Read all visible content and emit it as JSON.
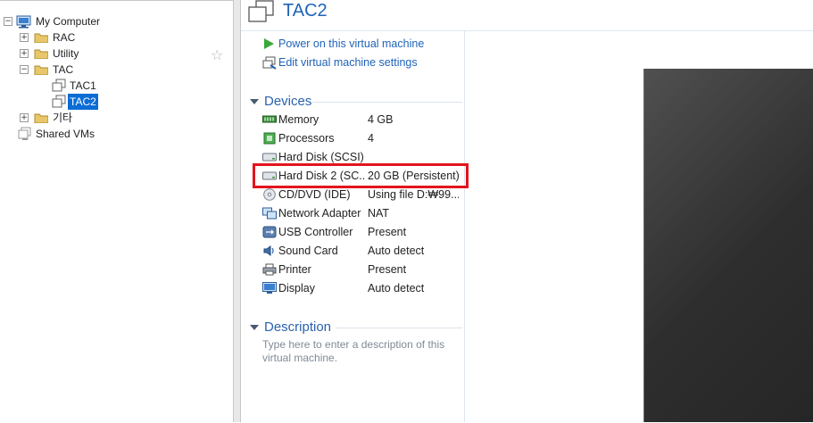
{
  "tree": {
    "root": {
      "label": "My Computer",
      "expander": "−"
    },
    "items": [
      {
        "label": "RAC",
        "expander": "+"
      },
      {
        "label": "Utility",
        "expander": "+"
      },
      {
        "label": "TAC",
        "expander": "−"
      },
      {
        "label": "TAC1"
      },
      {
        "label": "TAC2",
        "selected": true
      },
      {
        "label": "기타",
        "expander": "+"
      },
      {
        "label": "Shared VMs"
      }
    ],
    "favorite_icon": "star-icon",
    "favorite_glyph": "☆"
  },
  "vm": {
    "title": "TAC2",
    "commands": {
      "power_on": "Power on this virtual machine",
      "edit_settings": "Edit virtual machine settings"
    }
  },
  "devices": {
    "heading": "Devices",
    "items": [
      {
        "name": "Memory",
        "value": "4 GB",
        "icon": "memory-icon"
      },
      {
        "name": "Processors",
        "value": "4",
        "icon": "processor-icon"
      },
      {
        "name": "Hard Disk (SCSI)",
        "value": "",
        "icon": "hard-disk-icon"
      },
      {
        "name": "Hard Disk 2 (SC...",
        "value": "20 GB (Persistent)",
        "icon": "hard-disk-icon"
      },
      {
        "name": "CD/DVD (IDE)",
        "value": "Using file D:₩99...",
        "icon": "cd-dvd-icon"
      },
      {
        "name": "Network Adapter",
        "value": "NAT",
        "icon": "network-adapter-icon"
      },
      {
        "name": "USB Controller",
        "value": "Present",
        "icon": "usb-icon"
      },
      {
        "name": "Sound Card",
        "value": "Auto detect",
        "icon": "sound-icon"
      },
      {
        "name": "Printer",
        "value": "Present",
        "icon": "printer-icon"
      },
      {
        "name": "Display",
        "value": "Auto detect",
        "icon": "display-icon"
      }
    ]
  },
  "description": {
    "heading": "Description",
    "placeholder": "Type here to enter a description of this virtual machine."
  },
  "colors": {
    "accent": "#1f63b8",
    "selection": "#0b6cd6",
    "highlight": "#e3141e"
  }
}
